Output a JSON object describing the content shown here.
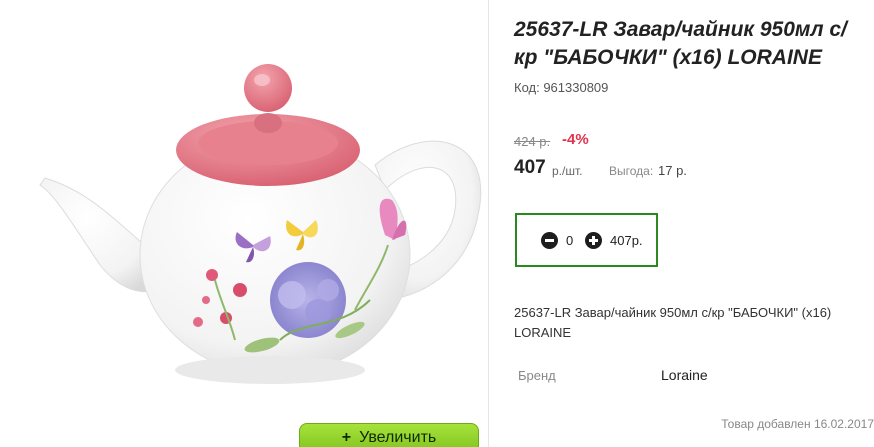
{
  "product": {
    "title": "25637-LR Завар/чайник 950мл с/кр \"БАБОЧКИ\" (x16) LORAINE",
    "code": "Код: 961330809",
    "old_price": "424 р.",
    "discount": "-4%",
    "price": "407",
    "price_unit": "р./шт.",
    "savings_label": "Выгода:",
    "savings_value": "17 р.",
    "description": "25637-LR Завар/чайник 950мл с/кр \"БАБОЧКИ\" (x16) LORAINE",
    "brand_label": "Бренд",
    "brand_value": "Loraine",
    "added_date": "Товар добавлен 16.02.2017"
  },
  "cart": {
    "quantity": "0",
    "total": "407р."
  },
  "image_panel": {
    "zoom_plus": "+",
    "zoom_label": "Увеличить"
  },
  "colors": {
    "lid_pink": "#e06b7a",
    "qty_border": "#2a8a1f",
    "discount": "#e0334d",
    "zoom_button": "#8fd02a"
  }
}
